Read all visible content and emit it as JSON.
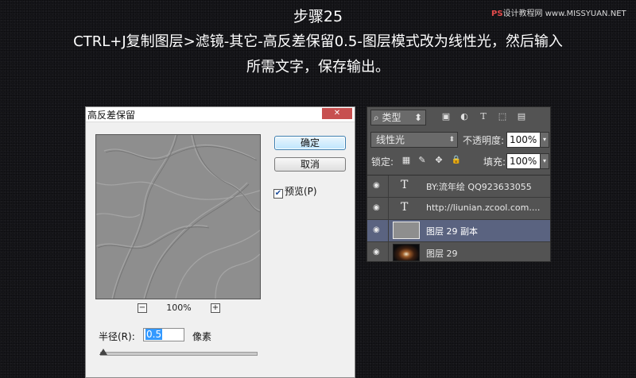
{
  "watermark": {
    "brand": "PS",
    "text": "设计教程网",
    "site": "www.MISSYUAN.NET"
  },
  "heading": {
    "step": "步骤25",
    "line1": "CTRL+J复制图层>滤镜-其它-高反差保留0.5-图层模式改为线性光，然后输入",
    "line2": "所需文字，保存输出。"
  },
  "dialog": {
    "title": "高反差保留",
    "close_glyph": "✕",
    "ok_label": "确定",
    "cancel_label": "取消",
    "preview_checked": true,
    "check_glyph": "✔",
    "preview_label": "预览(P)",
    "zoom_out_glyph": "−",
    "zoom_in_glyph": "+",
    "zoom_level": "100%",
    "radius_label": "半径(R):",
    "radius_value": "0.5",
    "radius_unit": "像素",
    "radius_slider_fraction": 0.0
  },
  "layers_panel": {
    "filter_label": "⌕ 类型",
    "filter_arrow": "⬍",
    "filter_icons": {
      "image": "▣",
      "adjust": "◐",
      "type": "T",
      "shape": "⬚",
      "smart": "▤"
    },
    "blend_mode": "线性光",
    "opacity_label": "不透明度:",
    "opacity_value": "100%",
    "lock_label": "锁定:",
    "lock_icons": {
      "pixels": "▦",
      "brush": "✎",
      "move": "✥",
      "all": "🔒"
    },
    "fill_label": "填充:",
    "fill_value": "100%",
    "dropdown_glyph": "▾",
    "eye_glyph": "◉",
    "type_glyph": "T",
    "layers": [
      {
        "name": "BY:流年绘  QQ923633055"
      },
      {
        "name": "http://liunian.zcool.com...."
      },
      {
        "name": "图层 29 副本"
      },
      {
        "name": "图层 29"
      }
    ]
  },
  "colors": {
    "background": "#16161a",
    "selected_layer": "#5a6380",
    "ok_button": "#bee6fd",
    "selection_highlight": "#3399ff"
  }
}
